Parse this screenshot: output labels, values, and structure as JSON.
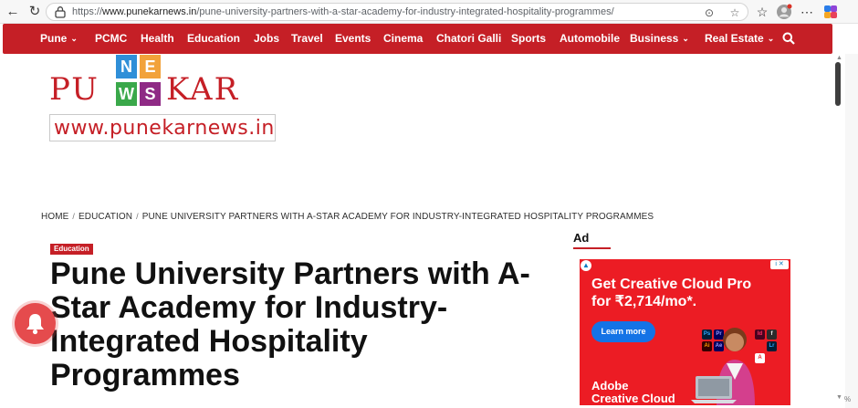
{
  "browser": {
    "url_prefix": "https://",
    "url_domain": "www.punekarnews.in",
    "url_path": "/pune-university-partners-with-a-star-academy-for-industry-integrated-hospitality-programmes/",
    "zoom_hint": "%"
  },
  "nav": {
    "items": [
      {
        "label": "Pune",
        "has_dropdown": true
      },
      {
        "label": "PCMC",
        "has_dropdown": false
      },
      {
        "label": "Health",
        "has_dropdown": false
      },
      {
        "label": "Education",
        "has_dropdown": false
      },
      {
        "label": "Jobs",
        "has_dropdown": false
      },
      {
        "label": "Travel",
        "has_dropdown": false
      },
      {
        "label": "Events",
        "has_dropdown": false
      },
      {
        "label": "Cinema",
        "has_dropdown": false
      },
      {
        "label": "Chatori Galli",
        "has_dropdown": false
      },
      {
        "label": "Sports",
        "has_dropdown": false
      },
      {
        "label": "Automobile",
        "has_dropdown": false
      },
      {
        "label": "Business",
        "has_dropdown": true
      },
      {
        "label": "Real Estate",
        "has_dropdown": true
      }
    ],
    "chevron": "⌄",
    "bg_color": "#c51f26"
  },
  "logo": {
    "left_text": "PU",
    "right_text": "KAR",
    "tiles": [
      "N",
      "E",
      "W",
      "S"
    ],
    "tile_colors": [
      "#2f8fd8",
      "#f2a23a",
      "#3aa84a",
      "#8f2a85"
    ],
    "url": "www.punekarnews.in"
  },
  "breadcrumb": {
    "items": [
      "HOME",
      "EDUCATION",
      "PUNE UNIVERSITY PARTNERS WITH A-STAR ACADEMY FOR INDUSTRY-INTEGRATED HOSPITALITY PROGRAMMES"
    ],
    "separator": "/"
  },
  "article": {
    "category": "Education",
    "title": "Pune University Partners with A-Star Academy for Industry-Integrated Hospitality Programmes"
  },
  "sidebar": {
    "ad_label": "Ad"
  },
  "ad": {
    "headline": "Get Creative Cloud Pro for ₹2,714/mo*.",
    "cta": "Learn more",
    "brand_line1": "Adobe",
    "brand_line2": "Creative Cloud",
    "info_label": "i ✕",
    "app_tiles": [
      "Ps",
      "Pr",
      "Ai",
      "Ae",
      "Id",
      "Lr"
    ]
  },
  "colors": {
    "brand_red": "#c51f26",
    "ad_red": "#ec1c24",
    "ad_button": "#1473e6",
    "bell": "#e54b4d"
  }
}
